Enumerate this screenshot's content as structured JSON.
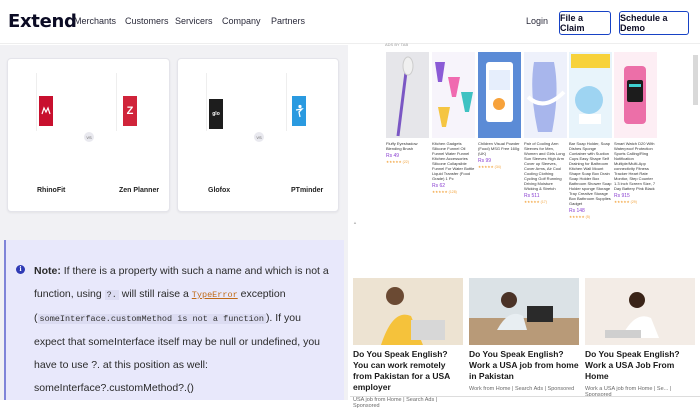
{
  "header": {
    "logo": "Extend",
    "nav": [
      "Merchants",
      "Customers",
      "Servicers",
      "Company",
      "Partners"
    ],
    "login": "Login",
    "file_claim": "File a Claim",
    "schedule_demo": "Schedule a Demo"
  },
  "comparisons": [
    {
      "left": {
        "name": "RhinoFit",
        "color": "#c8102e"
      },
      "vs": "VS",
      "right": {
        "name": "Zen Planner",
        "color": "#d0243a"
      }
    },
    {
      "left": {
        "name": "Glofox",
        "color": "#1d1d1d"
      },
      "vs": "VS",
      "right": {
        "name": "PTminder",
        "color": "#2a9ae0"
      }
    }
  ],
  "note": {
    "label": "Note:",
    "text1": " If there is a property with such a name and which is not a function, using ",
    "code1": "?.",
    "text2": " will still raise a ",
    "code2": "TypeError",
    "text3": " exception (",
    "code3": "someInterface.customMethod is not a function",
    "text4": "). If you expect that someInterface itself may be null or undefined, you have to use ?. at this position as well: someInterface?.customMethod?.()"
  },
  "ads": {
    "label": "ADS BY TAB",
    "products": [
      {
        "title": "Fluffy Eyeshadow Blending Brush",
        "price": "Rs 49",
        "old": "",
        "stars": "★★★★★ (22)"
      },
      {
        "title": "Kitchen Gadgets Silicone Funnel Oil Funnel Water Funnel Kitchen Accessories Silicone Collapsible Funnel For Water Bottle Liquid Transfer (Food Grade) 1 Pc",
        "price": "Rs 62",
        "old": "Rs 135",
        "stars": "★★★★★ (128)"
      },
      {
        "title": "Children Visual Powder (Food) MSG Free 160g (UK)",
        "price": "Rs 99",
        "old": "Rs 149",
        "stars": "★★★★★ (34)"
      },
      {
        "title": "Pair of Cooling Arm Sleeves for Men, Women and Girls Long Sun Sleeves High Arm Cover up Sleeves, Cover Arms, Air Cool Cooling Clothing Cycling Golf Running Driving Moisture Wicking & Stretch",
        "price": "Rs 511",
        "old": "Rs 899",
        "stars": "★★★★★ (17)"
      },
      {
        "title": "Bar Soap Holder, Soap Dishes Sponge Container with Suction Cups Easy Shape Self Draining for Bathroom Kitchen Wall Mount Shape Soap Box Drain Soap Holder Box Bathroom Shower Soap Holder sponge Storage Tray Creative Storage Box Bathroom Supplies Gadget",
        "price": "Rs 148",
        "old": "Rs 299",
        "stars": "★★★★★ (5)"
      },
      {
        "title": "Smart Watch D20 With Waterproof Protection Sports Calling/Ring Notification Multiple/Multi-App connectivity Fitness Tracker Heart Rate Monitor, Step Counter 1.3 inch Screen Size, 7 Day Battery Pink Black",
        "price": "Rs 915",
        "old": "Rs 2,499",
        "stars": "★★★★★ (29)"
      }
    ],
    "articles": [
      {
        "title": "Do You Speak English? You can work remotely from Pakistan for a USA employer",
        "source": "USA job from Home | Search Ads | Sponsored"
      },
      {
        "title": "Do You Speak English? Work a USA job from home in Pakistan",
        "source": "Work from Home | Search Ads | Sponsored"
      },
      {
        "title": "Do You Speak English? Work a USA Job From Home",
        "source": "Work a USA job from Home | Se... | Sponsored"
      }
    ]
  }
}
